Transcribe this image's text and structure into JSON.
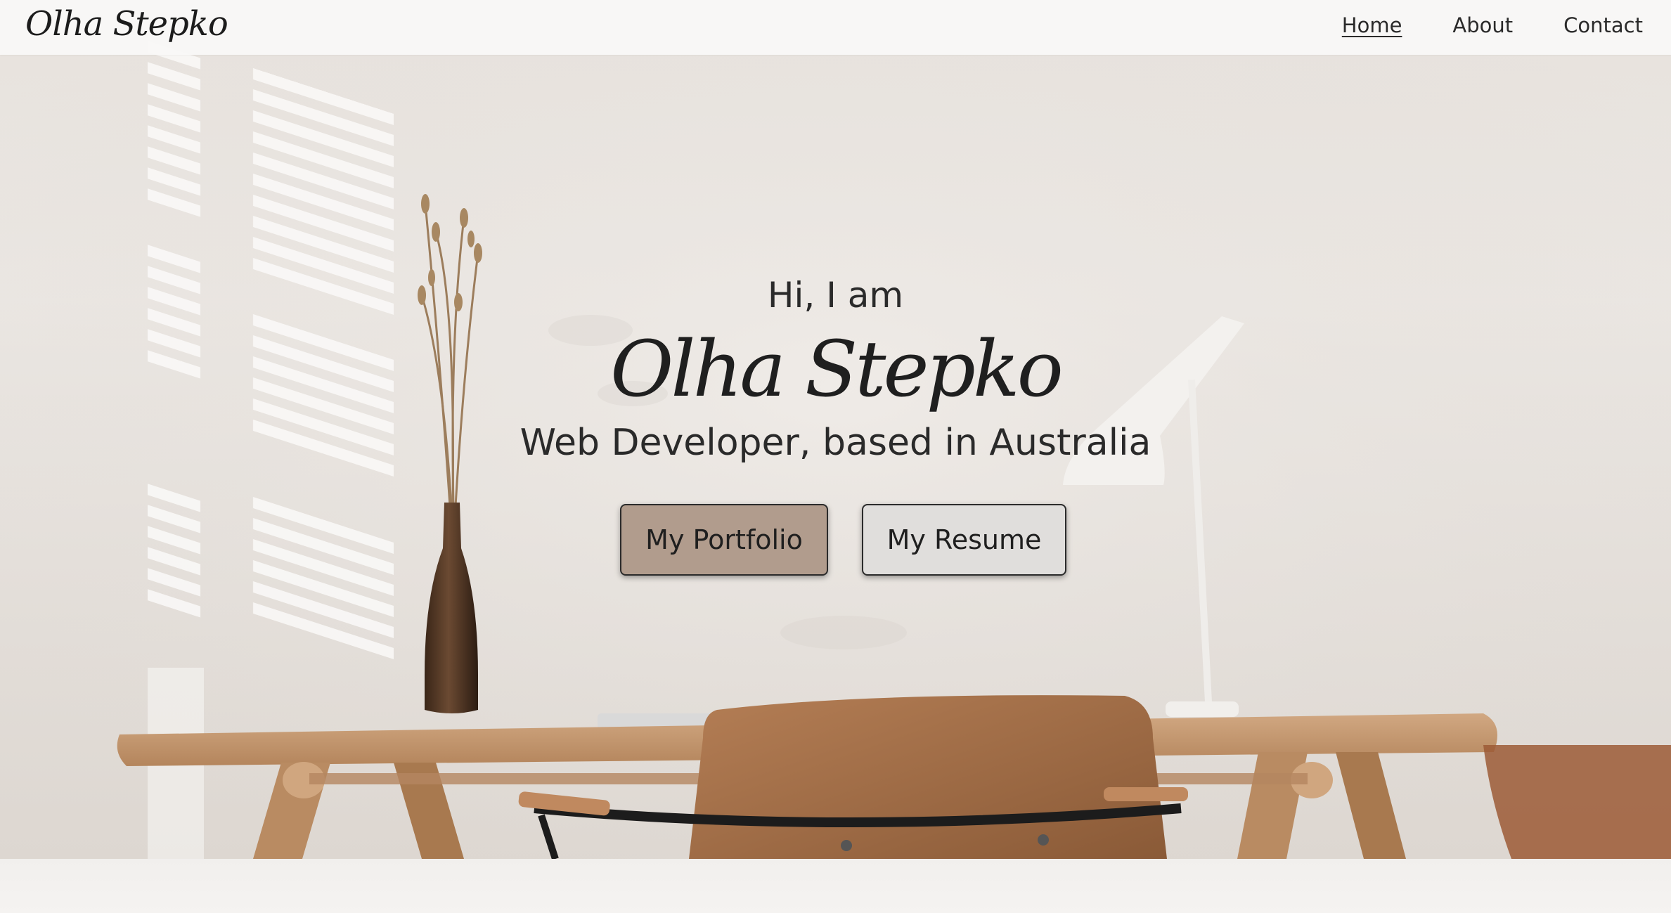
{
  "navbar": {
    "brand": "Olha Stepko",
    "links": [
      {
        "label": "Home",
        "active": true
      },
      {
        "label": "About",
        "active": false
      },
      {
        "label": "Contact",
        "active": false
      }
    ]
  },
  "hero": {
    "greeting": "Hi, I am",
    "name": "Olha Stepko",
    "tagline": "Web Developer, based in Australia",
    "buttons": {
      "portfolio": "My Portfolio",
      "resume": "My Resume"
    }
  },
  "colors": {
    "portfolio_button": "#b19c8d",
    "resume_button": "#e0dedc",
    "text": "#2a2a2a",
    "desk_wood": "#c49a73"
  }
}
